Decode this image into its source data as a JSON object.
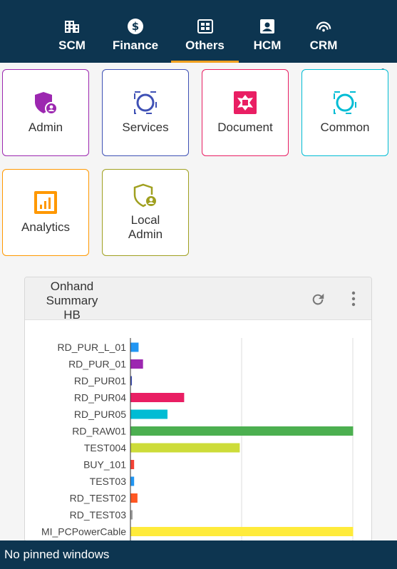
{
  "nav": {
    "tabs": [
      {
        "label": "SCM",
        "icon": "building-icon"
      },
      {
        "label": "Finance",
        "icon": "dollar-icon"
      },
      {
        "label": "Others",
        "icon": "app-grid-icon",
        "active": true
      },
      {
        "label": "HCM",
        "icon": "contact-card-icon"
      },
      {
        "label": "CRM",
        "icon": "signal-icon"
      }
    ]
  },
  "tiles": [
    {
      "label": "Admin",
      "color": "#9c27b0",
      "icon": "shield-user-icon"
    },
    {
      "label": "Services",
      "color": "#3f51b5",
      "icon": "circle-frame-icon"
    },
    {
      "label": "Document",
      "color": "#e91e63",
      "icon": "puzzle-icon"
    },
    {
      "label": "Common",
      "color": "#00bcd4",
      "icon": "circle-frame-icon"
    },
    {
      "label": "Analytics",
      "color": "#ff9800",
      "icon": "bar-chart-icon"
    },
    {
      "label": "Local Admin",
      "label_line1": "Local",
      "label_line2": "Admin",
      "color": "#a0a020",
      "icon": "shield-user-icon"
    }
  ],
  "widget": {
    "title": "Onhand Summary HB",
    "title_line1": "Onhand",
    "title_line2": "Summary",
    "title_line3": "HB"
  },
  "chart_data": {
    "type": "bar",
    "orientation": "horizontal",
    "categories": [
      "RD_PUR_L_01",
      "RD_PUR_01",
      "RD_PUR01",
      "RD_PUR04",
      "RD_PUR05",
      "RD_RAW01",
      "TEST004",
      "BUY_101",
      "TEST03",
      "RD_TEST02",
      "RD_TEST03",
      "MI_PCPowerCable"
    ],
    "values": [
      3.5,
      5.5,
      0.5,
      24,
      16.5,
      100,
      49,
      1.5,
      1.5,
      3,
      0.8,
      100
    ],
    "colors": [
      "#2196f3",
      "#9c27b0",
      "#3f51b5",
      "#e91e63",
      "#00bcd4",
      "#4caf50",
      "#cddc39",
      "#f44336",
      "#2196f3",
      "#ff5722",
      "#9e9e9e",
      "#ffeb3b"
    ],
    "xlim": [
      0,
      100
    ],
    "grid": true
  },
  "footer": {
    "text": "No pinned windows"
  }
}
